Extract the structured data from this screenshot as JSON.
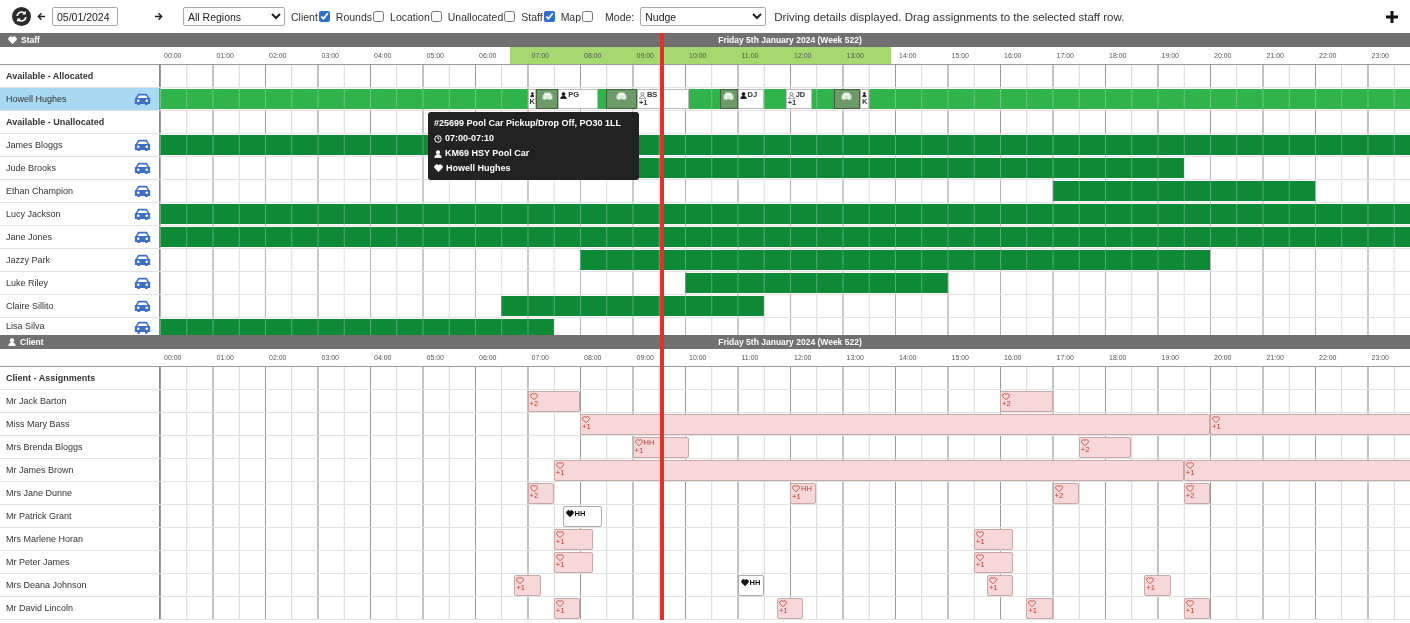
{
  "toolbar": {
    "date": "05/01/2024",
    "region": "All Regions",
    "filters": [
      {
        "label": "Client",
        "checked": true
      },
      {
        "label": "Rounds",
        "checked": false
      },
      {
        "label": "Location",
        "checked": false
      },
      {
        "label": "Unallocated",
        "checked": false
      },
      {
        "label": "Staff",
        "checked": true
      },
      {
        "label": "Map",
        "checked": false
      }
    ],
    "mode_label": "Mode:",
    "mode": "Nudge",
    "message": "Driving details displayed. Drag assignments to the selected staff row."
  },
  "staff": {
    "title": "Staff",
    "date_title": "Friday 5th January 2024 (Week 522)",
    "hours": [
      "00:00",
      "01:00",
      "02:00",
      "03:00",
      "04:00",
      "05:00",
      "06:00",
      "07:00",
      "08:00",
      "09:00",
      "10:00",
      "11:00",
      "12:00",
      "13:00",
      "14:00",
      "15:00",
      "16:00",
      "17:00",
      "18:00",
      "19:00",
      "20:00",
      "21:00",
      "22:00",
      "23:00"
    ],
    "rows": [
      {
        "kind": "group",
        "label": "Available - Allocated"
      },
      {
        "kind": "staff",
        "name": "Howell Hughes",
        "selected": true,
        "bars": [
          {
            "kind": "allocated"
          },
          {
            "kind": "driver",
            "initials": "K"
          },
          {
            "kind": "vehicle"
          },
          {
            "kind": "driver",
            "initials": "PG"
          },
          {
            "kind": "vehicle"
          },
          {
            "kind": "passenger",
            "initials": "BS",
            "extra": "+1"
          },
          {
            "kind": "vehicle"
          },
          {
            "kind": "driver",
            "initials": "DJ"
          },
          {
            "kind": "passenger",
            "initials": "JD",
            "extra": "+1"
          },
          {
            "kind": "vehicle"
          },
          {
            "kind": "driver",
            "initials": "K"
          }
        ]
      },
      {
        "kind": "group",
        "label": "Available - Unallocated"
      },
      {
        "kind": "staff",
        "name": "James Bloggs",
        "selected": false,
        "bars": [
          {
            "kind": "available"
          }
        ]
      },
      {
        "kind": "staff",
        "name": "Jude Brooks",
        "selected": false,
        "bars": [
          {
            "kind": "available"
          }
        ]
      },
      {
        "kind": "staff",
        "name": "Ethan Champion",
        "selected": false,
        "bars": [
          {
            "kind": "available"
          }
        ]
      },
      {
        "kind": "staff",
        "name": "Lucy Jackson",
        "selected": false,
        "bars": [
          {
            "kind": "available"
          }
        ]
      },
      {
        "kind": "staff",
        "name": "Jane Jones",
        "selected": false,
        "bars": [
          {
            "kind": "available"
          }
        ]
      },
      {
        "kind": "staff",
        "name": "Jazzy Park",
        "selected": false,
        "bars": [
          {
            "kind": "available"
          }
        ]
      },
      {
        "kind": "staff",
        "name": "Luke Riley",
        "selected": false,
        "bars": [
          {
            "kind": "available"
          }
        ]
      },
      {
        "kind": "staff",
        "name": "Claire Sillito",
        "selected": false,
        "bars": [
          {
            "kind": "available"
          }
        ]
      },
      {
        "kind": "staff",
        "name": "Lisa Silva",
        "selected": false,
        "bars": [
          {
            "kind": "available"
          }
        ]
      }
    ],
    "tooltip": {
      "title": "#25699 Pool Car Pickup/Drop Off, PO30 1LL",
      "time": "07:00-07:10",
      "vehicle": "KM69 HSY Pool Car",
      "staff": "Howell Hughes"
    }
  },
  "client": {
    "title": "Client",
    "date_title": "Friday 5th January 2024 (Week 522)",
    "hours": [
      "00:00",
      "01:00",
      "02:00",
      "03:00",
      "04:00",
      "05:00",
      "06:00",
      "07:00",
      "08:00",
      "09:00",
      "10:00",
      "11:00",
      "12:00",
      "13:00",
      "14:00",
      "15:00",
      "16:00",
      "17:00",
      "18:00",
      "19:00",
      "20:00",
      "21:00",
      "22:00",
      "23:00"
    ],
    "rows": [
      {
        "kind": "group",
        "label": "Client - Assignments"
      },
      {
        "kind": "client",
        "name": "Mr Jack Barton",
        "bars": [
          {
            "kind": "pending",
            "extra": "+2"
          },
          {
            "kind": "pending",
            "extra": "+2"
          }
        ]
      },
      {
        "kind": "client",
        "name": "Miss Mary Bass",
        "bars": [
          {
            "kind": "pending",
            "extra": "+1"
          },
          {
            "kind": "pending",
            "extra": "+1"
          }
        ]
      },
      {
        "kind": "client",
        "name": "Mrs Brenda Bloggs",
        "bars": [
          {
            "kind": "pending",
            "initials": "HH",
            "extra": "+1"
          },
          {
            "kind": "pending",
            "extra": "+2"
          }
        ]
      },
      {
        "kind": "client",
        "name": "Mr James Brown",
        "bars": [
          {
            "kind": "pending",
            "extra": "+1"
          },
          {
            "kind": "pending",
            "extra": "+1"
          }
        ]
      },
      {
        "kind": "client",
        "name": "Mrs Jane Dunne",
        "bars": [
          {
            "kind": "pending",
            "extra": "+2"
          },
          {
            "kind": "pending",
            "initials": "HH",
            "extra": "+1"
          },
          {
            "kind": "pending",
            "extra": "+2"
          },
          {
            "kind": "pending",
            "extra": "+2"
          }
        ]
      },
      {
        "kind": "client",
        "name": "Mr Patrick Grant",
        "bars": [
          {
            "kind": "assigned",
            "initials": "HH"
          }
        ]
      },
      {
        "kind": "client",
        "name": "Mrs Marlene Horan",
        "bars": [
          {
            "kind": "pending",
            "extra": "+1"
          },
          {
            "kind": "pending",
            "extra": "+1"
          }
        ]
      },
      {
        "kind": "client",
        "name": "Mr Peter James",
        "bars": [
          {
            "kind": "pending",
            "extra": "+1"
          },
          {
            "kind": "pending",
            "extra": "+1"
          }
        ]
      },
      {
        "kind": "client",
        "name": "Mrs Deana Johnson",
        "bars": [
          {
            "kind": "pending",
            "extra": "+1"
          },
          {
            "kind": "assigned",
            "initials": "HH"
          },
          {
            "kind": "pending",
            "extra": "+1"
          },
          {
            "kind": "pending",
            "extra": "+1"
          }
        ]
      },
      {
        "kind": "client",
        "name": "Mr David Lincoln",
        "bars": [
          {
            "kind": "pending",
            "extra": "+1"
          },
          {
            "kind": "pending",
            "extra": "+1"
          },
          {
            "kind": "pending",
            "extra": "+1"
          },
          {
            "kind": "pending",
            "extra": "+1"
          }
        ]
      }
    ]
  }
}
